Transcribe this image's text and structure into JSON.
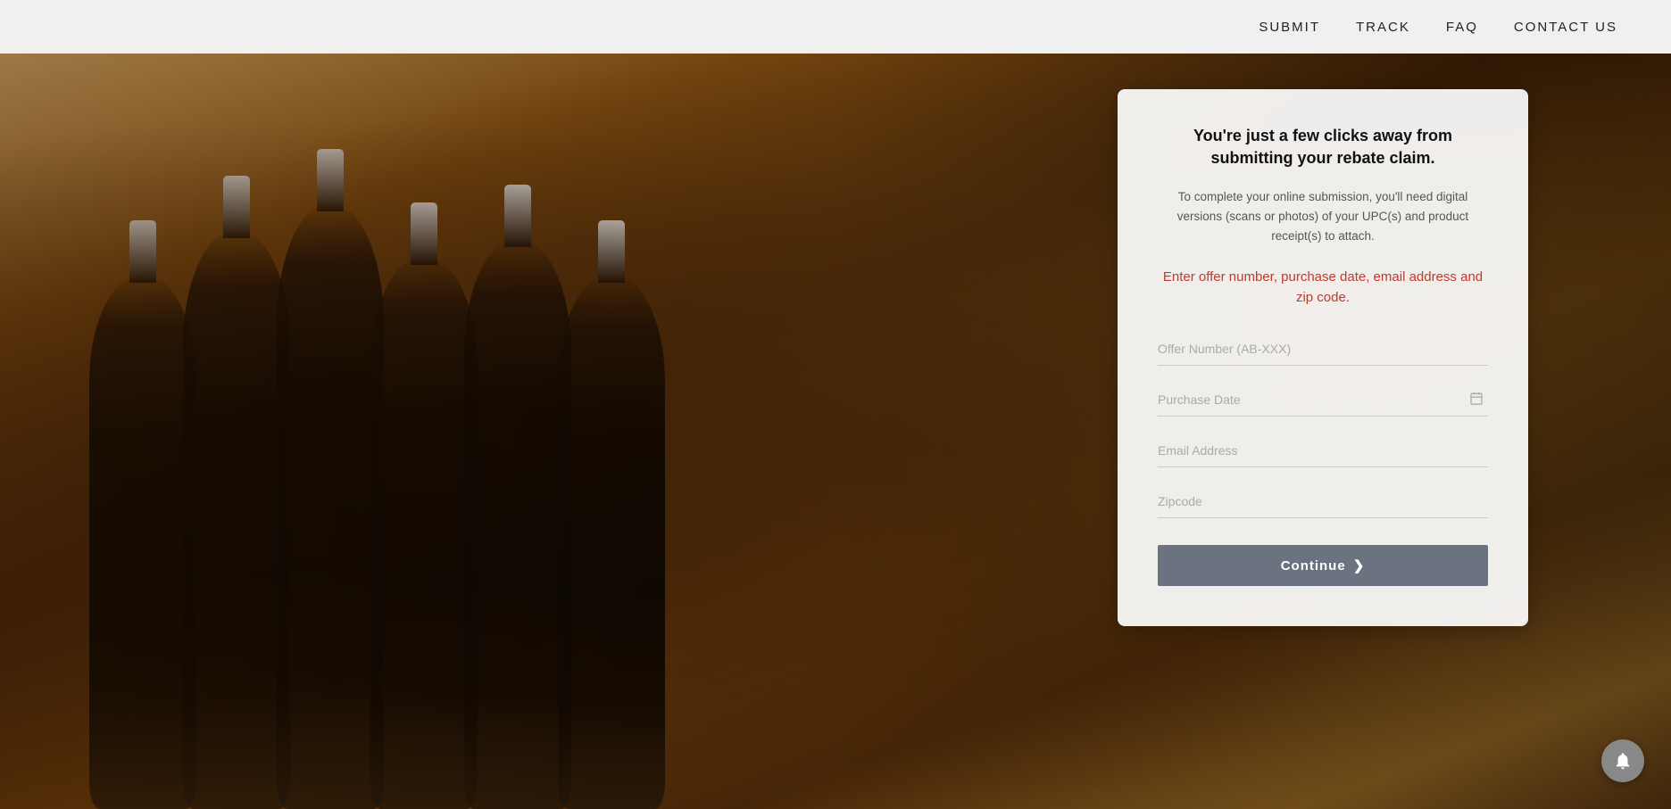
{
  "header": {
    "nav_items": [
      {
        "label": "SUBMIT",
        "href": "#"
      },
      {
        "label": "TRACK",
        "href": "#"
      },
      {
        "label": "FAQ",
        "href": "#"
      },
      {
        "label": "CONTACT US",
        "href": "#"
      }
    ]
  },
  "form": {
    "headline": "You're just a few clicks away from submitting your rebate claim.",
    "subtitle": "To complete your online submission, you'll need digital versions (scans or photos) of your UPC(s) and product receipt(s) to attach.",
    "instruction": "Enter offer number, purchase date, email address and zip code.",
    "fields": {
      "offer_number_placeholder": "Offer Number (AB-XXX)",
      "purchase_date_placeholder": "Purchase Date",
      "email_placeholder": "Email Address",
      "zipcode_placeholder": "Zipcode"
    },
    "continue_button": "Continue",
    "continue_arrow": "❯"
  }
}
